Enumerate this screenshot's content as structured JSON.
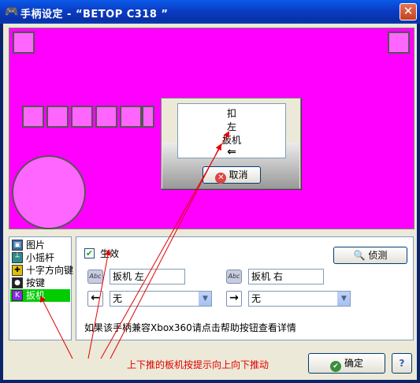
{
  "window": {
    "title": "手柄设定 - “BETOP C318 ”",
    "close_label": "✕"
  },
  "popup": {
    "line1": "扣",
    "line2": "左",
    "line3": "扳机",
    "arrow": "⇐",
    "cancel_label": "取消"
  },
  "sidebar": {
    "items": [
      {
        "label": "图片",
        "icon": "image-icon"
      },
      {
        "label": "小摇杆",
        "icon": "joystick-icon"
      },
      {
        "label": "十字方向键",
        "icon": "dpad-icon"
      },
      {
        "label": "按键",
        "icon": "button-icon"
      },
      {
        "label": "扳机",
        "icon": "trigger-icon",
        "selected": true
      }
    ]
  },
  "panel": {
    "enable_label": "生效",
    "enable_checked": true,
    "detect_label": "侦测",
    "abc_label": "Abc",
    "left_trigger_name": "扳机 左",
    "right_trigger_name": "扳机 右",
    "left_arrow": "←",
    "right_arrow": "→",
    "left_select": "无",
    "right_select": "无",
    "hint": "如果该手柄兼容Xbox360请点击帮助按钮查看详情"
  },
  "footer": {
    "annotation": "上下推的板机按提示向上向下推动",
    "ok_label": "确定",
    "help_label": "?"
  },
  "colors": {
    "pad": "#ff00ff",
    "annotation": "#e00000",
    "selected": "#00cc00"
  }
}
